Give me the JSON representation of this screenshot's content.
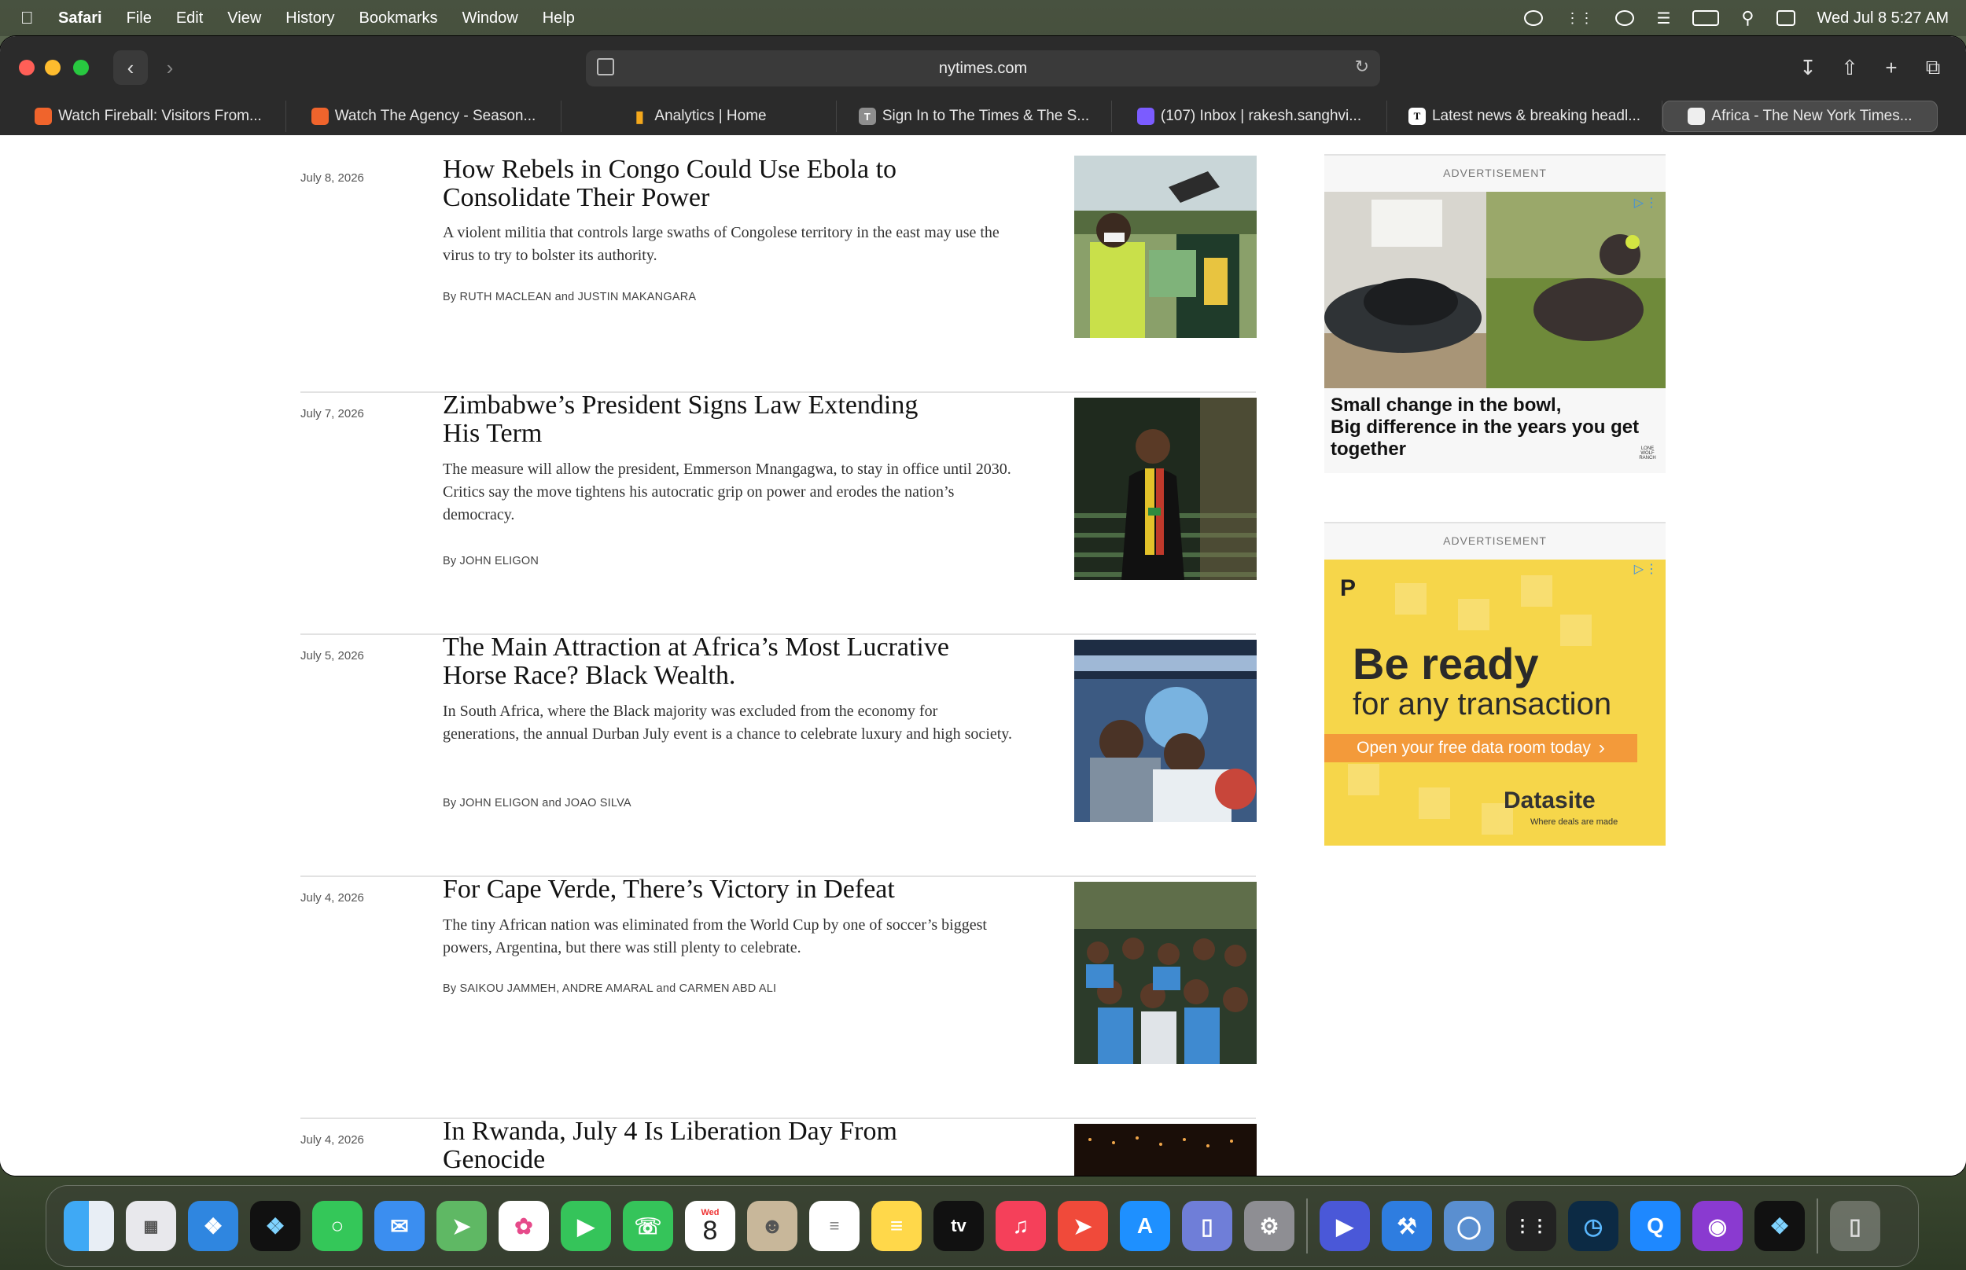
{
  "menubar": {
    "app": "Safari",
    "menus": [
      "File",
      "Edit",
      "View",
      "History",
      "Bookmarks",
      "Window",
      "Help"
    ],
    "datetime": "Wed Jul 8  5:27 AM"
  },
  "browser": {
    "url": "nytimes.com",
    "tabs": [
      {
        "label": "Watch Fireball: Visitors From...",
        "color": "#f0642c"
      },
      {
        "label": "Watch The Agency - Season...",
        "color": "#f0642c"
      },
      {
        "label": "Analytics | Home",
        "color": "#f4a81c"
      },
      {
        "label": "Sign In to The Times & The S...",
        "color": "#8e8e8e",
        "glyph": "T"
      },
      {
        "label": "(107) Inbox | rakesh.sanghvi...",
        "color": "#7b5cff"
      },
      {
        "label": "Latest news & breaking headl...",
        "color": "#ffffff",
        "glyph": "T"
      },
      {
        "label": "Africa - The New York Times...",
        "color": "#eeeeee"
      }
    ]
  },
  "articles": [
    {
      "date": "July 8, 2026",
      "headline": "How Rebels in Congo Could Use Ebola to Consolidate Their Power",
      "summary": "A violent militia that controls large swaths of Congolese territory in the east may use the virus to try to bolster its authority.",
      "byline": "By RUTH MACLEAN and JUSTIN MAKANGARA"
    },
    {
      "date": "July 7, 2026",
      "headline": "Zimbabwe’s President Signs Law Extending His Term",
      "summary": "The measure will allow the president, Emmerson Mnangagwa, to stay in office until 2030. Critics say the move tightens his autocratic grip on power and erodes the nation’s democracy.",
      "byline": "By JOHN ELIGON"
    },
    {
      "date": "July 5, 2026",
      "headline": "The Main Attraction at Africa’s Most Lucrative Horse Race? Black Wealth.",
      "summary": "In South Africa, where the Black majority was excluded from the economy for generations, the annual Durban July event is a chance to celebrate luxury and high society.",
      "byline": "By JOHN ELIGON and JOAO SILVA"
    },
    {
      "date": "July 4, 2026",
      "headline": "For Cape Verde, There’s Victory in Defeat",
      "summary": "The tiny African nation was eliminated from the World Cup by one of soccer’s biggest powers, Argentina, but there was still plenty to celebrate.",
      "byline": "By SAIKOU JAMMEH, ANDRE AMARAL and CARMEN ABD ALI"
    },
    {
      "date": "July 4, 2026",
      "headline": "In Rwanda, July 4 Is Liberation Day From Genocide",
      "summary": "",
      "byline": ""
    }
  ],
  "ads": [
    {
      "label": "ADVERTISEMENT",
      "headline": "Small change in the bowl,\nBig difference in the years you get together",
      "brand": "LONE WOLF RANCH"
    },
    {
      "label": "ADVERTISEMENT",
      "title": "Be ready",
      "subtitle": "for any transaction",
      "cta": "Open your free data room today",
      "brand": "Datasite",
      "tagline": "Where deals are made",
      "mark": "P"
    }
  ],
  "dock": {
    "calendar_day_label": "Wed",
    "calendar_day": "8",
    "tv_label": "tv",
    "apps": [
      "finder",
      "launchpad",
      "safari",
      "copilot",
      "messages",
      "mail",
      "maps",
      "photos",
      "facetime",
      "phone",
      "calendar",
      "contacts",
      "reminders",
      "notes",
      "apple-tv",
      "music",
      "rocket",
      "app-store",
      "simulator",
      "system-settings",
      "remote",
      "xcode",
      "disk",
      "grid",
      "speedometer",
      "quick",
      "github",
      "copilot-2",
      "trash"
    ]
  }
}
